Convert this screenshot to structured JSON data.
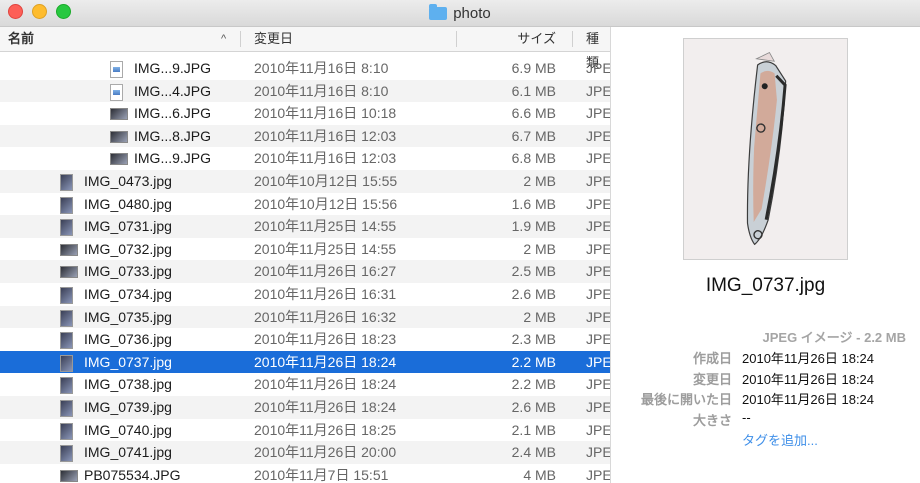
{
  "window": {
    "title": "photo",
    "folder_icon": "folder-icon",
    "colors": {
      "close": "#fd5f57",
      "minimize": "#febc2e",
      "maximize": "#28c840",
      "selection": "#1a6dd9"
    }
  },
  "columns": {
    "name": "名前",
    "date": "変更日",
    "size": "サイズ",
    "kind": "種類"
  },
  "files": [
    {
      "name": "IMG...9.JPG",
      "date": "2010年11月16日 8:10",
      "size": "6.9 MB",
      "kind": "JPE",
      "indent": 1,
      "thumb": "doc"
    },
    {
      "name": "IMG...4.JPG",
      "date": "2010年11月16日 8:10",
      "size": "6.1 MB",
      "kind": "JPE",
      "indent": 1,
      "thumb": "doc"
    },
    {
      "name": "IMG...6.JPG",
      "date": "2010年11月16日 10:18",
      "size": "6.6 MB",
      "kind": "JPE",
      "indent": 1,
      "thumb": "h"
    },
    {
      "name": "IMG...8.JPG",
      "date": "2010年11月16日 12:03",
      "size": "6.7 MB",
      "kind": "JPE",
      "indent": 1,
      "thumb": "h"
    },
    {
      "name": "IMG...9.JPG",
      "date": "2010年11月16日 12:03",
      "size": "6.8 MB",
      "kind": "JPE",
      "indent": 1,
      "thumb": "h"
    },
    {
      "name": "IMG_0473.jpg",
      "date": "2010年10月12日 15:55",
      "size": "2 MB",
      "kind": "JPE",
      "indent": 0,
      "thumb": "v"
    },
    {
      "name": "IMG_0480.jpg",
      "date": "2010年10月12日 15:56",
      "size": "1.6 MB",
      "kind": "JPE",
      "indent": 0,
      "thumb": "v"
    },
    {
      "name": "IMG_0731.jpg",
      "date": "2010年11月25日 14:55",
      "size": "1.9 MB",
      "kind": "JPE",
      "indent": 0,
      "thumb": "v"
    },
    {
      "name": "IMG_0732.jpg",
      "date": "2010年11月25日 14:55",
      "size": "2 MB",
      "kind": "JPE",
      "indent": 0,
      "thumb": "h"
    },
    {
      "name": "IMG_0733.jpg",
      "date": "2010年11月26日 16:27",
      "size": "2.5 MB",
      "kind": "JPE",
      "indent": 0,
      "thumb": "h"
    },
    {
      "name": "IMG_0734.jpg",
      "date": "2010年11月26日 16:31",
      "size": "2.6 MB",
      "kind": "JPE",
      "indent": 0,
      "thumb": "v"
    },
    {
      "name": "IMG_0735.jpg",
      "date": "2010年11月26日 16:32",
      "size": "2 MB",
      "kind": "JPE",
      "indent": 0,
      "thumb": "v"
    },
    {
      "name": "IMG_0736.jpg",
      "date": "2010年11月26日 18:23",
      "size": "2.3 MB",
      "kind": "JPE",
      "indent": 0,
      "thumb": "v"
    },
    {
      "name": "IMG_0737.jpg",
      "date": "2010年11月26日 18:24",
      "size": "2.2 MB",
      "kind": "JPE",
      "indent": 0,
      "thumb": "v",
      "selected": true
    },
    {
      "name": "IMG_0738.jpg",
      "date": "2010年11月26日 18:24",
      "size": "2.2 MB",
      "kind": "JPE",
      "indent": 0,
      "thumb": "v"
    },
    {
      "name": "IMG_0739.jpg",
      "date": "2010年11月26日 18:24",
      "size": "2.6 MB",
      "kind": "JPE",
      "indent": 0,
      "thumb": "v"
    },
    {
      "name": "IMG_0740.jpg",
      "date": "2010年11月26日 18:25",
      "size": "2.1 MB",
      "kind": "JPE",
      "indent": 0,
      "thumb": "v"
    },
    {
      "name": "IMG_0741.jpg",
      "date": "2010年11月26日 20:00",
      "size": "2.4 MB",
      "kind": "JPE",
      "indent": 0,
      "thumb": "v"
    },
    {
      "name": "PB075534.JPG",
      "date": "2010年11月7日 15:51",
      "size": "4 MB",
      "kind": "JPE",
      "indent": 0,
      "thumb": "h"
    }
  ],
  "preview": {
    "filename": "IMG_0737.jpg",
    "kind": "JPEG イメージ - 2.2 MB",
    "created_label": "作成日",
    "created": "2010年11月26日 18:24",
    "modified_label": "変更日",
    "modified": "2010年11月26日 18:24",
    "opened_label": "最後に開いた日",
    "opened": "2010年11月26日 18:24",
    "size_label": "大きさ",
    "size_value": "--",
    "add_tags": "タグを追加..."
  }
}
